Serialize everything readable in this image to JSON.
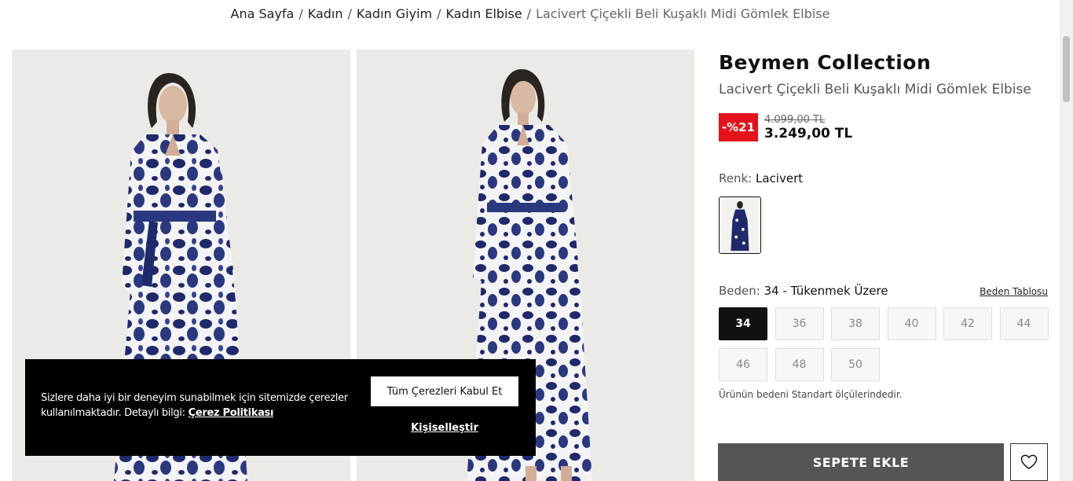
{
  "breadcrumb": {
    "items": [
      "Ana Sayfa",
      "Kadın",
      "Kadın Giyim",
      "Kadın Elbise"
    ],
    "current": "Lacivert Çiçekli Beli Kuşaklı Midi Gömlek Elbise",
    "separator": "/"
  },
  "product": {
    "brand": "Beymen Collection",
    "name": "Lacivert Çiçekli Beli Kuşaklı Midi Gömlek Elbise",
    "discount": "-%21",
    "old_price": "4.099,00 TL",
    "price": "3.249,00 TL"
  },
  "color": {
    "label": "Renk:",
    "value": "Lacivert"
  },
  "size": {
    "label": "Beden:",
    "value": "34 - Tükenmek Üzere",
    "table_link": "Beden Tablosu",
    "options": [
      "34",
      "36",
      "38",
      "40",
      "42",
      "44",
      "46",
      "48",
      "50"
    ],
    "selected": "34",
    "note": "Ürünün bedeni Standart ölçülerindedir."
  },
  "actions": {
    "add_to_cart": "SEPETE EKLE"
  },
  "cookie": {
    "text": "Sizlere daha iyi bir deneyim sunabilmek için sitemizde çerezler kullanılmaktadır. Detaylı bilgi: ",
    "policy_link": "Çerez Politikası",
    "accept": "Tüm Çerezleri Kabul Et",
    "customize": "Kişiselleştir"
  },
  "icons": {
    "wishlist": "heart-icon"
  },
  "colors": {
    "discount_badge": "#e4121a",
    "add_to_cart_bg": "#555555",
    "dress_navy": "#1e2a6b",
    "cookie_bg": "#000000"
  }
}
